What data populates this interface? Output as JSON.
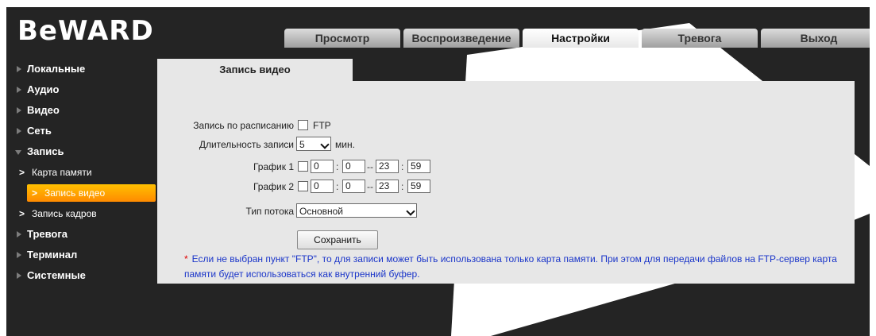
{
  "brand": {
    "logo_text": "BeWARD"
  },
  "tabs": [
    {
      "label": "Просмотр",
      "active": false
    },
    {
      "label": "Воспроизведение",
      "active": false
    },
    {
      "label": "Настройки",
      "active": true
    },
    {
      "label": "Тревога",
      "active": false
    },
    {
      "label": "Выход",
      "active": false
    }
  ],
  "sidebar": {
    "items": [
      {
        "label": "Локальные"
      },
      {
        "label": "Аудио"
      },
      {
        "label": "Видео"
      },
      {
        "label": "Сеть"
      },
      {
        "label": "Запись",
        "expanded": true
      },
      {
        "label": "Тревога"
      },
      {
        "label": "Терминал"
      },
      {
        "label": "Системные"
      }
    ],
    "record_sub_items": [
      {
        "label": "Карта памяти",
        "active": false
      },
      {
        "label": "Запись видео",
        "active": true
      },
      {
        "label": "Запись кадров",
        "active": false
      }
    ]
  },
  "content": {
    "tab_title": "Запись видео",
    "schedule_label": "Запись по расписанию",
    "ftp_label": "FTP",
    "ftp_checked": false,
    "duration_label": "Длительность записи",
    "duration_value": "5",
    "duration_unit": "мин.",
    "schedule1": {
      "label": "График 1",
      "checked": false,
      "start_h": "0",
      "start_m": "0",
      "end_h": "23",
      "end_m": "59"
    },
    "schedule2": {
      "label": "График 2",
      "checked": false,
      "start_h": "0",
      "start_m": "0",
      "end_h": "23",
      "end_m": "59"
    },
    "stream_label": "Тип потока",
    "stream_value": "Основной",
    "save_label": "Сохранить",
    "note_star": "*",
    "note_line1": "Если не выбран пункт \"FTP\", то для записи может быть использована только карта памяти. При этом для передачи файлов на FTP-сервер карта",
    "note_line2": "памяти будет использоваться как внутренний буфер."
  },
  "colors": {
    "background": "#242424",
    "panel": "#e7e7e7",
    "accent": "#ff9a00",
    "note_text": "#1a35c9",
    "note_star": "#e00000"
  }
}
